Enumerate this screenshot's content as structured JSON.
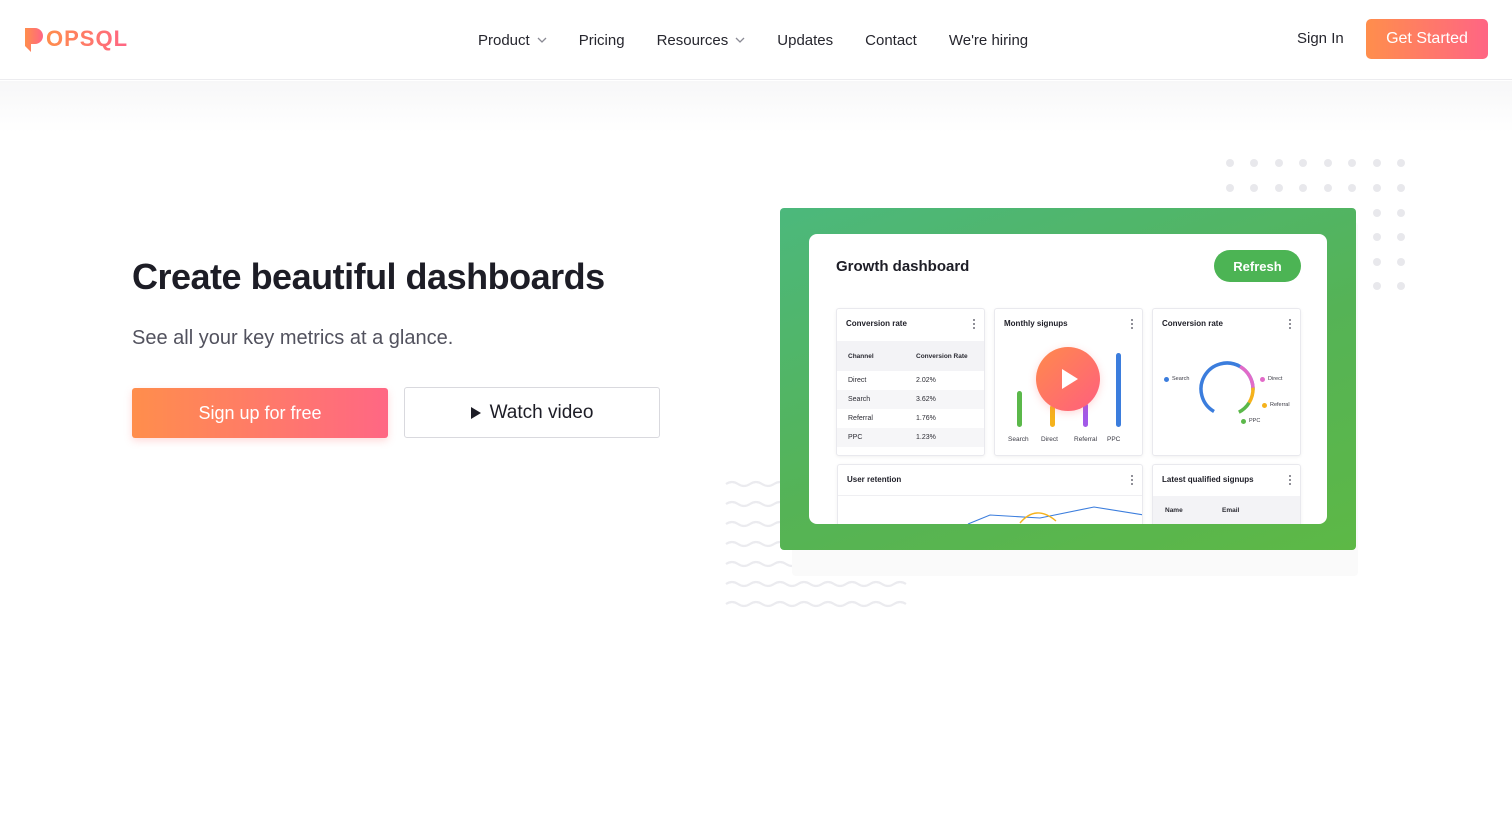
{
  "nav": {
    "logo_text": "POPSQL",
    "items": [
      {
        "label": "Product",
        "dropdown": true
      },
      {
        "label": "Pricing",
        "dropdown": false
      },
      {
        "label": "Resources",
        "dropdown": true
      },
      {
        "label": "Updates",
        "dropdown": false
      },
      {
        "label": "Contact",
        "dropdown": false
      },
      {
        "label": "We're hiring",
        "dropdown": false
      }
    ],
    "sign_in": "Sign In",
    "get_started": "Get Started"
  },
  "hero": {
    "title": "Create beautiful dashboards",
    "subtitle": "See all your key metrics at a glance.",
    "primary_cta": "Sign up for free",
    "secondary_cta": "Watch video"
  },
  "dashboard": {
    "title": "Growth dashboard",
    "refresh_label": "Refresh",
    "conversion_table": {
      "title": "Conversion rate",
      "columns": [
        "Channel",
        "Conversion Rate"
      ],
      "rows": [
        [
          "Direct",
          "2.02%"
        ],
        [
          "Search",
          "3.62%"
        ],
        [
          "Referral",
          "1.76%"
        ],
        [
          "PPC",
          "1.23%"
        ]
      ]
    },
    "monthly_signups": {
      "title": "Monthly signups",
      "bars": [
        {
          "label": "Search",
          "value": 0.45,
          "color": "#5bb84a"
        },
        {
          "label": "Direct",
          "value": 0.28,
          "color": "#f5b21c"
        },
        {
          "label": "Referral",
          "value": 0.3,
          "color": "#a259e8"
        },
        {
          "label": "PPC",
          "value": 0.92,
          "color": "#3b7ddd"
        }
      ]
    },
    "conversion_donut": {
      "title": "Conversion rate",
      "legend": [
        {
          "label": "Search",
          "color": "#3b7ddd"
        },
        {
          "label": "Direct",
          "color": "#e26bc8"
        },
        {
          "label": "Referral",
          "color": "#f5b21c"
        },
        {
          "label": "PPC",
          "color": "#5bb84a"
        }
      ]
    },
    "user_retention": {
      "title": "User retention"
    },
    "latest_signups": {
      "title": "Latest qualified signups",
      "columns": [
        "Name",
        "Email"
      ]
    }
  },
  "colors": {
    "brand_gradient_start": "#ff8e4c",
    "brand_gradient_end": "#ff6584",
    "dashboard_green": "#55b356",
    "refresh_green": "#4cb454"
  }
}
